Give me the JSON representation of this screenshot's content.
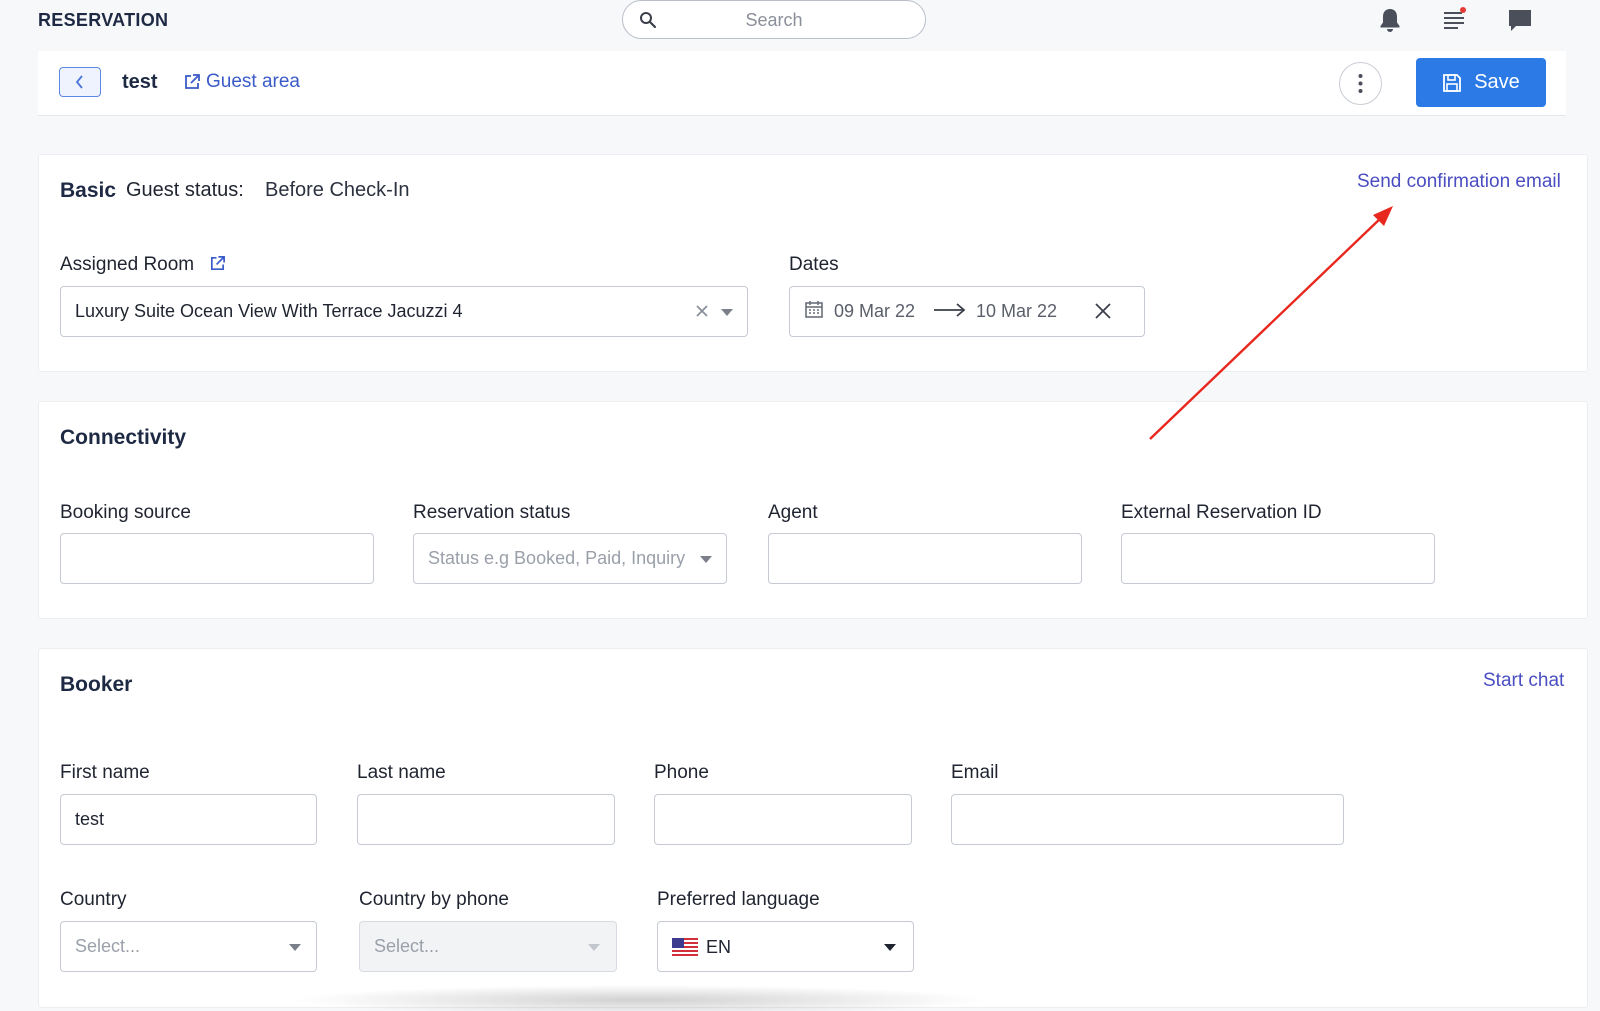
{
  "app": {
    "title": "RESERVATION"
  },
  "search": {
    "placeholder": "Search"
  },
  "header": {
    "reservation_name": "test",
    "guest_area_label": "Guest area",
    "save_label": "Save"
  },
  "basic": {
    "title": "Basic",
    "guest_status_label": "Guest status:",
    "guest_status_value": "Before Check-In",
    "send_confirmation_label": "Send confirmation email",
    "assigned_room_label": "Assigned Room",
    "assigned_room_value": "Luxury Suite Ocean View With Terrace Jacuzzi 4",
    "dates_label": "Dates",
    "date_start": "09 Mar 22",
    "date_end": "10 Mar 22"
  },
  "connectivity": {
    "title": "Connectivity",
    "booking_source_label": "Booking source",
    "booking_source_value": "",
    "reservation_status_label": "Reservation status",
    "reservation_status_placeholder": "Status e.g Booked, Paid, Inquiry",
    "agent_label": "Agent",
    "agent_value": "",
    "external_id_label": "External Reservation ID",
    "external_id_value": ""
  },
  "booker": {
    "title": "Booker",
    "start_chat_label": "Start chat",
    "first_name_label": "First name",
    "first_name_value": "test",
    "last_name_label": "Last name",
    "last_name_value": "",
    "phone_label": "Phone",
    "phone_value": "",
    "email_label": "Email",
    "email_value": "",
    "country_label": "Country",
    "country_placeholder": "Select...",
    "country_by_phone_label": "Country by phone",
    "country_by_phone_placeholder": "Select...",
    "preferred_language_label": "Preferred language",
    "preferred_language_value": "EN"
  },
  "annotation": {
    "arrow_color": "#e8281e"
  },
  "colors": {
    "accent": "#2b7ae6",
    "link": "#4a4ec0",
    "notification_dot": "#e53935"
  }
}
